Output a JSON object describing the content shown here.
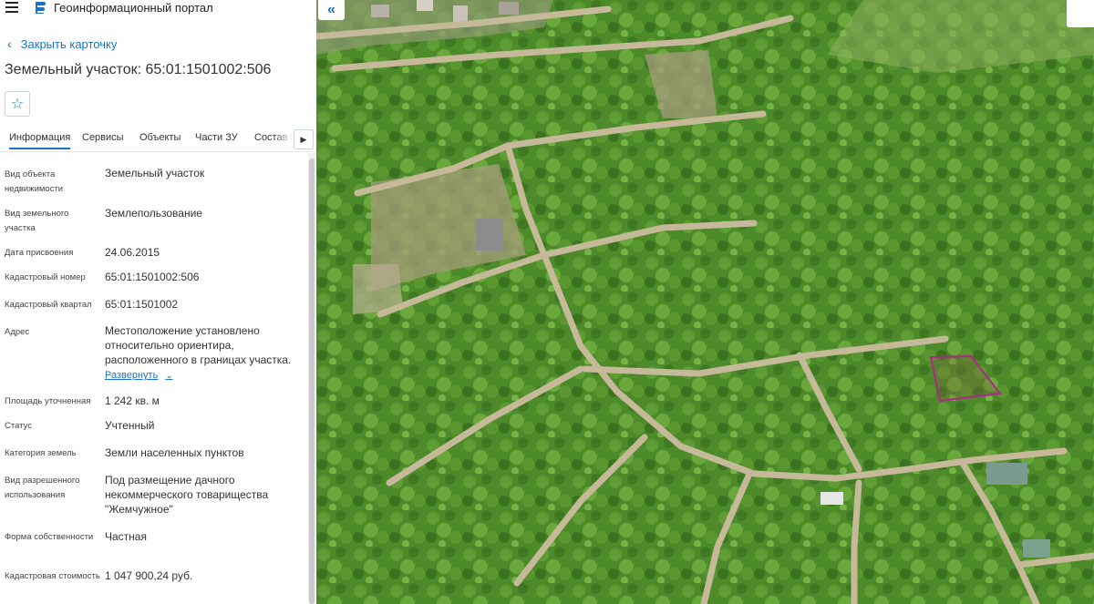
{
  "header": {
    "app_title": "Геоинформационный портал"
  },
  "card": {
    "close_label": "Закрыть карточку",
    "title": "Земельный участок: 65:01:1501002:506"
  },
  "tabs": [
    {
      "label": "Информация",
      "active": true
    },
    {
      "label": "Сервисы"
    },
    {
      "label": "Объекты"
    },
    {
      "label": "Части ЗУ"
    },
    {
      "label": "Состав Е"
    }
  ],
  "fields": [
    {
      "label": "Вид объекта недвижимости",
      "value": "Земельный участок"
    },
    {
      "label": "Вид земельного участка",
      "value": "Землепользование"
    },
    {
      "label": "Дата присвоения",
      "value": "24.06.2015"
    },
    {
      "label": "Кадастровый номер",
      "value": "65:01:1501002:506"
    },
    {
      "label": "Кадастровый квартал",
      "value": "65:01:1501002"
    },
    {
      "label": "Адрес",
      "value": "Местоположение установлено относительно ориентира, расположенного в границах участка."
    },
    {
      "label": "Площадь уточненная",
      "value": "1 242 кв. м"
    },
    {
      "label": "Статус",
      "value": "Учтенный"
    },
    {
      "label": "Категория земель",
      "value": "Земли населенных пунктов"
    },
    {
      "label": "Вид разрешенного использования",
      "value": "Под размещение дачного некоммерческого товарищества \"Жемчужное\""
    },
    {
      "label": "Форма собственности",
      "value": "Частная"
    },
    {
      "label": "Кадастровая стоимость",
      "value": "1 047 900,24 руб."
    }
  ],
  "expand_label": "Развернуть",
  "colors": {
    "accent": "#1a73c9",
    "parcel_outline": "#b0268a"
  },
  "icons": [
    "menu-icon",
    "portal-logo-icon",
    "chevron-left-icon",
    "star-icon",
    "chevron-right-icon",
    "chevron-down-icon",
    "double-chevron-left-icon"
  ]
}
